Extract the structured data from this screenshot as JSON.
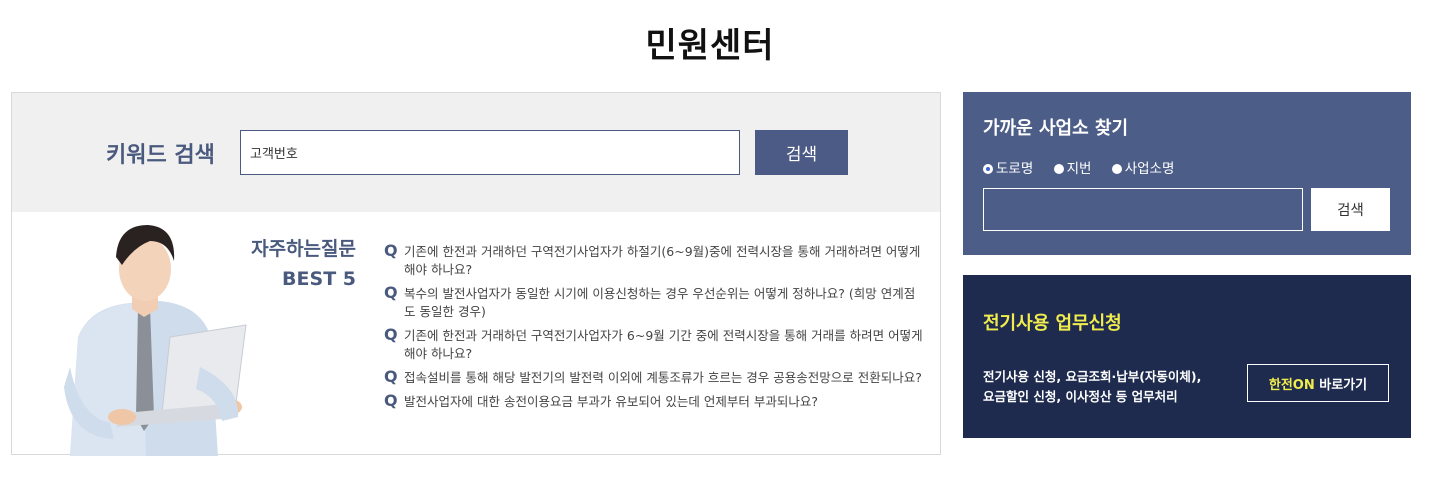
{
  "page_title": "민원센터",
  "keyword_search": {
    "label": "키워드 검색",
    "input_value": "고객번호",
    "button_label": "검색"
  },
  "faq": {
    "heading_line1": "자주하는질문",
    "heading_line2": "BEST 5",
    "marker": "Q",
    "items": [
      "기존에 한전과 거래하던 구역전기사업자가 하절기(6~9월)중에 전력시장을 통해 거래하려면 어떻게 해야 하나요?",
      "복수의 발전사업자가 동일한 시기에 이용신청하는 경우 우선순위는 어떻게 정하나요? (희망 연계점도 동일한 경우)",
      "기존에 한전과 거래하던 구역전기사업자가 6~9월 기간 중에 전력시장을 통해 거래를 하려면 어떻게 해야 하나요?",
      "접속설비를 통해 해당 발전기의 발전력 이외에 계통조류가 흐르는 경우 공용송전망으로 전환되나요?",
      "발전사업자에 대한 송전이용요금 부과가 유보되어 있는데 언제부터 부과되나요?"
    ]
  },
  "find_office": {
    "title": "가까운 사업소 찾기",
    "radios": [
      "도로명",
      "지번",
      "사업소명"
    ],
    "selected": "도로명",
    "input_value": "",
    "button_label": "검색"
  },
  "electric_service": {
    "title": "전기사용 업무신청",
    "desc_line1": "전기사용 신청, 요금조회·납부(자동이체),",
    "desc_line2": "요금할인 신청, 이사정산 등 업무처리",
    "button_highlight": "한전ON",
    "button_rest": " 바로가기"
  },
  "colors": {
    "accent": "#4c5b85",
    "navy": "#1e2b4f",
    "highlight_yellow": "#f1ed4c"
  }
}
